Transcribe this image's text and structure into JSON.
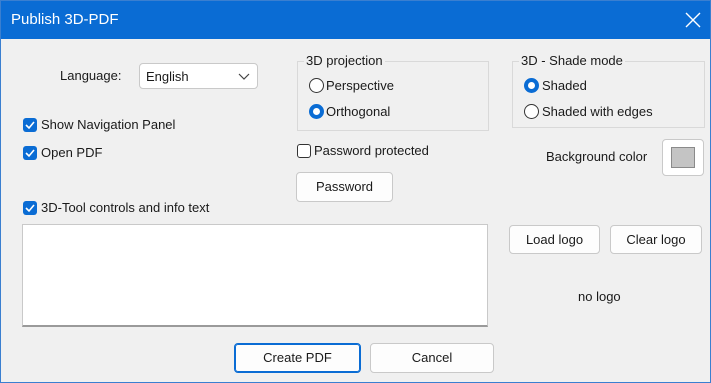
{
  "dialog": {
    "title": "Publish 3D-PDF",
    "close_icon": "close-icon"
  },
  "language": {
    "label": "Language:",
    "selected": "English"
  },
  "projection": {
    "legend": "3D projection",
    "options": [
      {
        "label": "Perspective",
        "selected": false
      },
      {
        "label": "Orthogonal",
        "selected": true
      }
    ]
  },
  "shade_mode": {
    "legend": "3D - Shade mode",
    "options": [
      {
        "label": "Shaded",
        "selected": true
      },
      {
        "label": "Shaded with edges",
        "selected": false
      }
    ]
  },
  "options": {
    "show_nav_panel": {
      "label": "Show Navigation Panel",
      "checked": true
    },
    "open_pdf": {
      "label": "Open PDF",
      "checked": true
    },
    "password_protected": {
      "label": "Password protected",
      "checked": false
    },
    "controls_info_text": {
      "label": "3D-Tool controls and info text",
      "checked": true
    }
  },
  "password_button": "Password",
  "background_color": {
    "label": "Background color",
    "value": "#c4c4c4"
  },
  "logo": {
    "load_label": "Load logo",
    "clear_label": "Clear logo",
    "status": "no logo"
  },
  "info_text_value": "",
  "footer": {
    "create_label": "Create PDF",
    "cancel_label": "Cancel"
  },
  "colors": {
    "accent": "#0a6cd4",
    "dialog_bg": "#f0f0f0"
  }
}
